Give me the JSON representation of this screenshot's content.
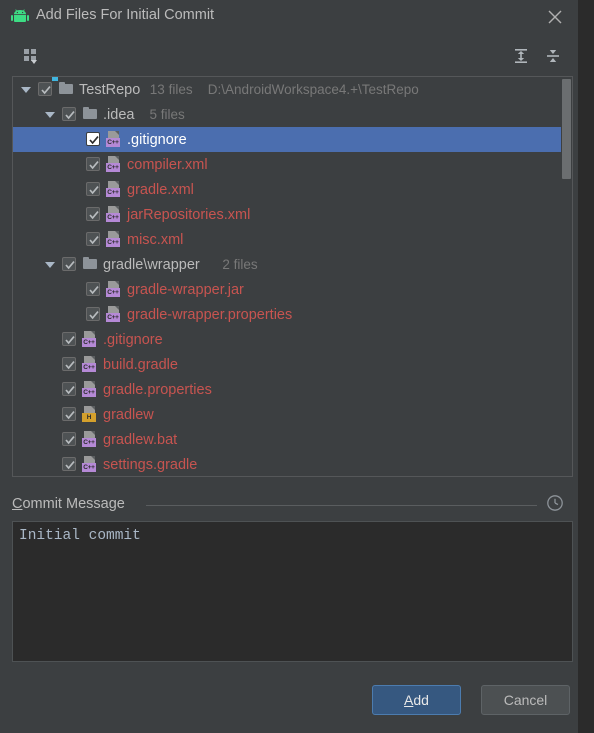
{
  "window": {
    "title": "Add Files For Initial Commit",
    "app_icon": "android-icon",
    "close_icon": "close-icon"
  },
  "toolbar": {
    "group_by_label": "group-by-icon",
    "expand_all_label": "expand-all-icon",
    "collapse_all_label": "collapse-all-icon"
  },
  "tree": {
    "rows": [
      {
        "depth": 0,
        "kind": "dir",
        "arrow": true,
        "checked": true,
        "selected": false,
        "label": "TestRepo",
        "count": "13 files",
        "path": "D:\\AndroidWorkspace4.+\\TestRepo",
        "icon": "folder-icon"
      },
      {
        "depth": 1,
        "kind": "dir",
        "arrow": true,
        "checked": true,
        "selected": false,
        "label": ".idea",
        "count": "5 files",
        "path": "",
        "icon": "folder-icon"
      },
      {
        "depth": 2,
        "kind": "file",
        "arrow": false,
        "checked": true,
        "selected": true,
        "label": ".gitignore",
        "count": "",
        "path": "",
        "icon": "file-icon",
        "badge": "C++"
      },
      {
        "depth": 2,
        "kind": "file",
        "arrow": false,
        "checked": true,
        "selected": false,
        "label": "compiler.xml",
        "count": "",
        "path": "",
        "icon": "file-icon",
        "badge": "C++"
      },
      {
        "depth": 2,
        "kind": "file",
        "arrow": false,
        "checked": true,
        "selected": false,
        "label": "gradle.xml",
        "count": "",
        "path": "",
        "icon": "file-icon",
        "badge": "C++"
      },
      {
        "depth": 2,
        "kind": "file",
        "arrow": false,
        "checked": true,
        "selected": false,
        "label": "jarRepositories.xml",
        "count": "",
        "path": "",
        "icon": "file-icon",
        "badge": "C++"
      },
      {
        "depth": 2,
        "kind": "file",
        "arrow": false,
        "checked": true,
        "selected": false,
        "label": "misc.xml",
        "count": "",
        "path": "",
        "icon": "file-icon",
        "badge": "C++"
      },
      {
        "depth": 1,
        "kind": "dir",
        "arrow": true,
        "checked": true,
        "selected": false,
        "label": "gradle\\wrapper",
        "count": "2 files",
        "path": "",
        "icon": "folder-icon"
      },
      {
        "depth": 2,
        "kind": "file",
        "arrow": false,
        "checked": true,
        "selected": false,
        "label": "gradle-wrapper.jar",
        "count": "",
        "path": "",
        "icon": "file-icon",
        "badge": "C++"
      },
      {
        "depth": 2,
        "kind": "file",
        "arrow": false,
        "checked": true,
        "selected": false,
        "label": "gradle-wrapper.properties",
        "count": "",
        "path": "",
        "icon": "file-icon",
        "badge": "C++"
      },
      {
        "depth": 1,
        "kind": "file",
        "arrow": false,
        "checked": true,
        "selected": false,
        "label": ".gitignore",
        "count": "",
        "path": "",
        "icon": "file-icon",
        "badge": "C++"
      },
      {
        "depth": 1,
        "kind": "file",
        "arrow": false,
        "checked": true,
        "selected": false,
        "label": "build.gradle",
        "count": "",
        "path": "",
        "icon": "file-icon",
        "badge": "C++"
      },
      {
        "depth": 1,
        "kind": "file",
        "arrow": false,
        "checked": true,
        "selected": false,
        "label": "gradle.properties",
        "count": "",
        "path": "",
        "icon": "file-icon",
        "badge": "C++"
      },
      {
        "depth": 1,
        "kind": "file",
        "arrow": false,
        "checked": true,
        "selected": false,
        "label": "gradlew",
        "count": "",
        "path": "",
        "icon": "file-icon",
        "badge": "H"
      },
      {
        "depth": 1,
        "kind": "file",
        "arrow": false,
        "checked": true,
        "selected": false,
        "label": "gradlew.bat",
        "count": "",
        "path": "",
        "icon": "file-icon",
        "badge": "C++"
      },
      {
        "depth": 1,
        "kind": "file",
        "arrow": false,
        "checked": true,
        "selected": false,
        "label": "settings.gradle",
        "count": "",
        "path": "",
        "icon": "file-icon",
        "badge": "C++"
      }
    ]
  },
  "commit": {
    "label_mnemonic": "C",
    "label_rest": "ommit Message",
    "history_icon": "clock-icon",
    "message": "Initial commit"
  },
  "buttons": {
    "add_mnemonic": "A",
    "add_rest": "dd",
    "cancel_label": "Cancel"
  },
  "colors": {
    "dialog_bg": "#3c3f41",
    "selection": "#4b6eaf",
    "unversioned_file": "#c75450",
    "directory_text": "#bbbbbb",
    "meta_text": "#787878",
    "primary_button": "#365880",
    "android_green": "#3ddc84",
    "badge_cpp": "#b589d6",
    "badge_h": "#d4a02c"
  }
}
